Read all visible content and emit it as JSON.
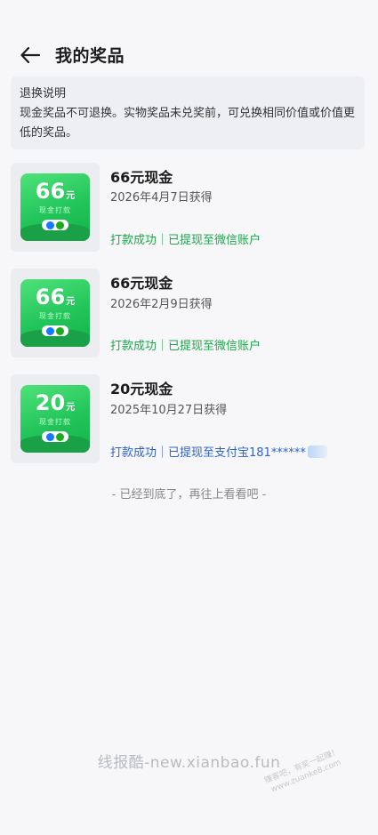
{
  "header": {
    "title": "我的奖品",
    "back_icon": "arrow-left-icon"
  },
  "notice": {
    "title": "退换说明",
    "body": "现金奖品不可退换。实物奖品未兑奖前，可兑换相同价值或价值更低的奖品。"
  },
  "prizes": [
    {
      "badge_amount": "66",
      "badge_unit": "元",
      "badge_sub": "现金打款",
      "name": "66元现金",
      "date": "2026年4月7日获得",
      "status": "打款成功｜已提现至微信账户",
      "status_color": "#1ea84a"
    },
    {
      "badge_amount": "66",
      "badge_unit": "元",
      "badge_sub": "现金打款",
      "name": "66元现金",
      "date": "2026年2月9日获得",
      "status": "打款成功｜已提现至微信账户",
      "status_color": "#1ea84a"
    },
    {
      "badge_amount": "20",
      "badge_unit": "元",
      "badge_sub": "现金打款",
      "name": "20元现金",
      "date": "2025年10月27日获得",
      "status": "打款成功｜已提现至支付宝181******",
      "status_color": "#2f63c8"
    }
  ],
  "footer": {
    "end_text": "- 已经到底了，再往上看看吧 -"
  },
  "watermark": {
    "text": "线报酷-new.xianbao.fun",
    "stamp_line1": "赚客吧，有奖一起赚！",
    "stamp_line2": "www.zuanke8.com"
  },
  "colors": {
    "accent_green": "#22c55a",
    "status_green": "#1ea84a",
    "status_blue": "#2f63c8"
  }
}
